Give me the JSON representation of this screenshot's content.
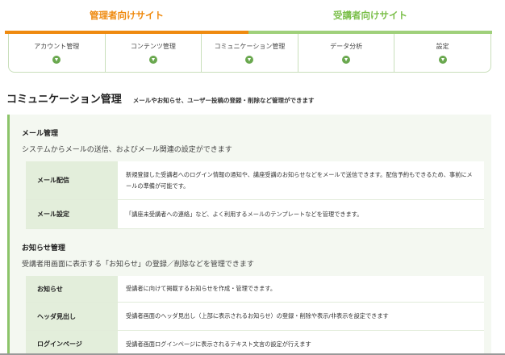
{
  "site_tabs": {
    "admin": "管理者向けサイト",
    "student": "受講者向けサイト"
  },
  "nav": [
    {
      "label": "アカウント管理"
    },
    {
      "label": "コンテンツ管理"
    },
    {
      "label": "コミュニケーション管理"
    },
    {
      "label": "データ分析"
    },
    {
      "label": "設定"
    }
  ],
  "section": {
    "title": "コミュニケーション管理",
    "desc": "メールやお知らせ、ユーザー投稿の登録・削除など管理ができます"
  },
  "mail": {
    "title": "メール管理",
    "desc": "システムからメールの送信、およびメール関連の設定ができます",
    "rows": [
      {
        "label": "メール配信",
        "text": "新規登録した受講者へのログイン情報の通知や、講座受講のお知らせなどをメールで送信できます。配信予約もできるため、事前にメールの準備が可能です。"
      },
      {
        "label": "メール設定",
        "text": "「講座未受講者への連絡」など、よく利用するメールのテンプレートなどを管理できます。"
      }
    ]
  },
  "notice": {
    "title": "お知らせ管理",
    "desc": "受講者用画面に表示する「お知らせ」の登録／削除などを管理できます",
    "rows": [
      {
        "label": "お知らせ",
        "text": "受講者に向けて掲載するお知らせを作成・管理できます。"
      },
      {
        "label": "ヘッダ見出し",
        "text": "受講者画面のヘッダ見出し（上部に表示されるお知らせ）の登録・削除や表示/非表示を設定できます"
      },
      {
        "label": "ログインページ",
        "text": "受講者画面ログインページに表示されるテキスト文言の設定が行えます"
      }
    ]
  }
}
